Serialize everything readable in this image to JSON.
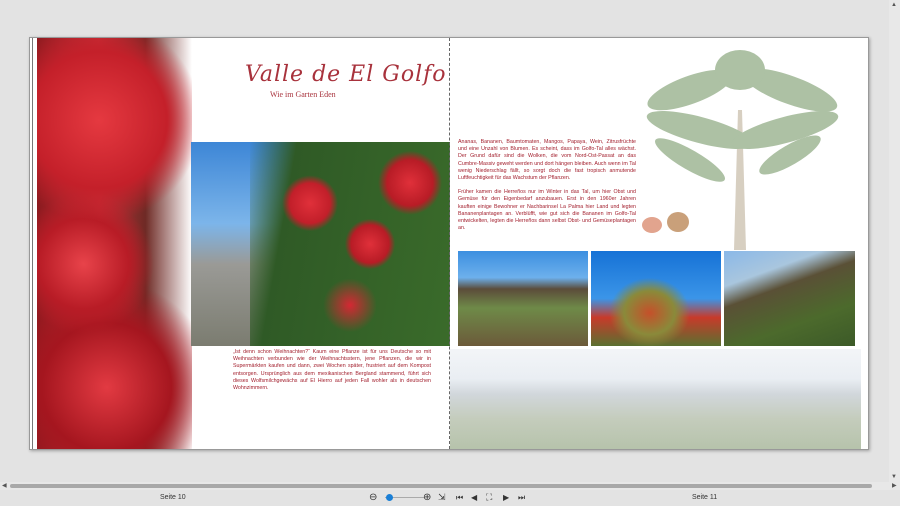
{
  "book": {
    "title": "Valle de El Golfo",
    "subtitle": "Wie im Garten Eden",
    "left_text": "„Ist denn schon Weihnachten?“ Kaum eine Pflanze ist für uns Deutsche so mit Weihnachten verbunden wie der Weihnachtsstern, jene Pflanzen, die wir in Supermärkten kaufen und dann, zwei Wochen später, frustriert auf dem Kompost entsorgen. Ursprünglich aus dem mexikanischen Bergland stammend, führt sich dieses Wolfsmilchgewächs auf El Hierro auf jeden Fall wohler als in deutschen Wohnzimmern.",
    "right_text": [
      "Ananas, Bananen, Baumtomaten, Mangos, Papaya, Wein, Zitrusfrüchte und eine Unzahl von Blumen. Es scheint, dass im Golfo-Tal alles wächst. Der Grund dafür sind die Wolken, die vom Nord-Ost-Passat an das Cumbre-Massiv geweht werden und dort hängen bleiben. Auch wenn im Tal wenig Niederschlag fällt, so sorgt doch die fast tropisch anmutende Luftfeuchtigkeit für das Wachstum der Pflanzen.",
      "Früher kamen die Herreños nur im Winter in das Tal, um hier Obst und Gemüse für den Eigenbedarf anzubauen. Erst in den 1960er Jahren kauften einige Bewohner er Nachbarinsel La Palma hier Land und legten Bananenplantagen an. Verblüfft, wie gut sich die Bananen im Golfo-Tal entwickelten, legten die Herreños dann selbst Obst- und Gemüseplantagen an."
    ]
  },
  "footer": {
    "left_page": "Seite 10",
    "right_page": "Seite 11",
    "zoom_level": 0.1
  },
  "colors": {
    "text": "#a3202e",
    "accent": "#1a7fd6"
  }
}
